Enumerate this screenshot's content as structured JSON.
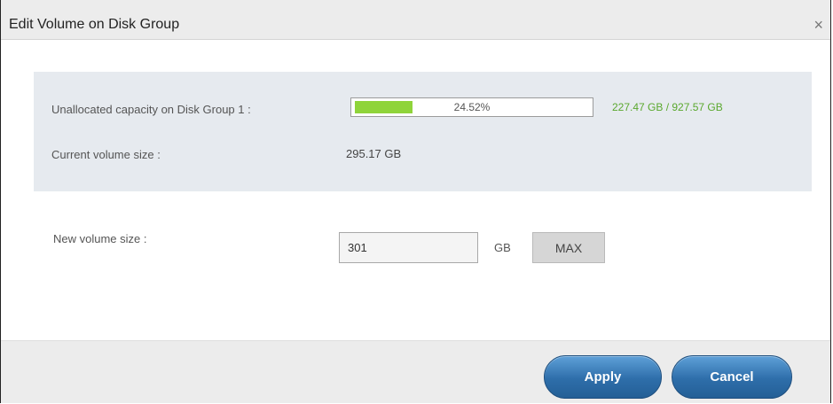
{
  "dialog": {
    "title": "Edit Volume on Disk Group",
    "close_glyph": "×"
  },
  "info": {
    "unallocated_label": "Unallocated capacity on Disk Group 1 :",
    "progress_text": "24.52%",
    "progress_fraction": 0.2452,
    "capacity_text": "227.47 GB / 927.57 GB",
    "current_label": "Current volume size :",
    "current_value": "295.17 GB"
  },
  "form": {
    "new_size_label": "New volume size :",
    "new_size_value": "301",
    "unit": "GB",
    "max_label": "MAX"
  },
  "footer": {
    "apply_label": "Apply",
    "cancel_label": "Cancel"
  },
  "colors": {
    "progress_fill": "#8fd43a",
    "capacity_text": "#5aa82e",
    "button_blue": "#2e6eaa"
  },
  "icons": {
    "close": "close-icon"
  }
}
